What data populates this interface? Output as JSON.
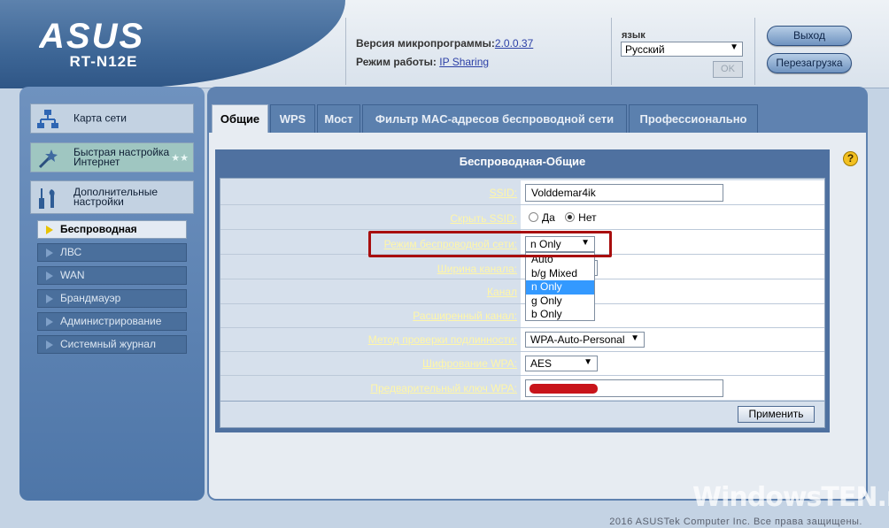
{
  "header": {
    "logo": "ASUS",
    "model": "RT-N12E",
    "firmware_label": "Версия микропрограммы:",
    "firmware_value": "2.0.0.37",
    "mode_label": "Режим работы:",
    "mode_value": "IP Sharing",
    "lang_label": "язык",
    "lang_value": "Русский",
    "ok_label": "OK",
    "logout_label": "Выход",
    "reboot_label": "Перезагрузка"
  },
  "sidebar": {
    "main_items": [
      {
        "label": "Карта сети",
        "icon": "network-map-icon"
      },
      {
        "label": "Быстрая настройка Интернет",
        "icon": "magic-wand-icon"
      },
      {
        "label": "Дополнительные настройки",
        "icon": "tools-icon"
      }
    ],
    "sub_items": [
      {
        "label": "Беспроводная"
      },
      {
        "label": "ЛВС"
      },
      {
        "label": "WAN"
      },
      {
        "label": "Брандмауэр"
      },
      {
        "label": "Администрирование"
      },
      {
        "label": "Системный журнал"
      }
    ]
  },
  "tabs": [
    {
      "label": "Общие"
    },
    {
      "label": "WPS"
    },
    {
      "label": "Мост"
    },
    {
      "label": "Фильтр MAC-адресов беспроводной сети"
    },
    {
      "label": "Профессионально"
    }
  ],
  "form": {
    "title": "Беспроводная-Общие",
    "ssid_label": "SSID:",
    "ssid_value": "Volddemar4ik",
    "hide_ssid_label": "Скрыть SSID:",
    "hide_yes": "Да",
    "hide_no": "Нет",
    "mode_label": "Режим беспроводной сети:",
    "mode_value": "n Only",
    "mode_options": [
      "Auto",
      "b/g Mixed",
      "n Only",
      "g Only",
      "b Only"
    ],
    "bandwidth_label": "Ширина канала:",
    "channel_label": "Канал",
    "ext_channel_label": "Расширенный канал:",
    "auth_label": "Метод проверки подлинности:",
    "auth_value": "WPA-Auto-Personal",
    "encryption_label": "Шифрование WPA:",
    "encryption_value": "AES",
    "psk_label": "Предварительный ключ WPA:",
    "apply_label": "Применить"
  },
  "footer": {
    "copyright": "2016 ASUSTek Computer Inc. Все права защищены.",
    "watermark": "WindowsTEN.ru"
  },
  "colors": {
    "accent": "#4f71a0",
    "label_yellow": "#fff6a8",
    "highlight_red": "#a80e0e"
  }
}
